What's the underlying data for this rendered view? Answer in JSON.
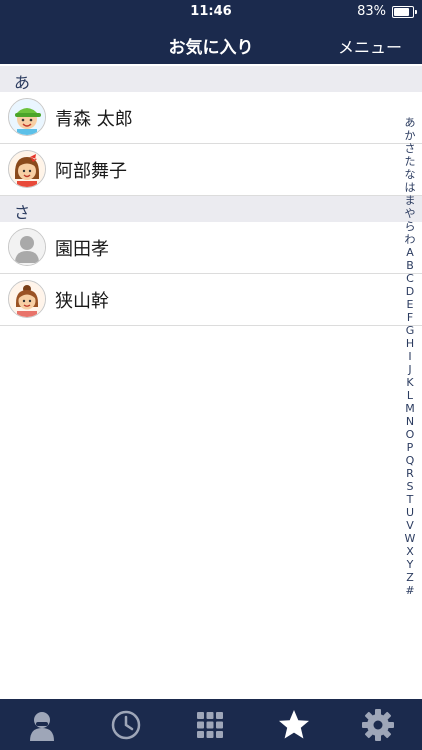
{
  "status": {
    "time": "11:46",
    "battery": "83%",
    "battery_level": 0.83
  },
  "nav": {
    "title": "お気に入り",
    "menu_label": "メニュー"
  },
  "sections": [
    {
      "label": "あ",
      "contacts": [
        {
          "name": "青森 太郎",
          "avatar": "boy-green-cap"
        },
        {
          "name": "阿部舞子",
          "avatar": "girl-red-bow"
        }
      ]
    },
    {
      "label": "さ",
      "contacts": [
        {
          "name": "園田孝",
          "avatar": "default-person"
        },
        {
          "name": "狭山幹",
          "avatar": "girl-brown-hair"
        }
      ]
    }
  ],
  "index_letters": [
    "あ",
    "か",
    "さ",
    "た",
    "な",
    "は",
    "ま",
    "や",
    "ら",
    "わ",
    "A",
    "B",
    "C",
    "D",
    "E",
    "F",
    "G",
    "H",
    "I",
    "J",
    "K",
    "L",
    "M",
    "N",
    "O",
    "P",
    "Q",
    "R",
    "S",
    "T",
    "U",
    "V",
    "W",
    "X",
    "Y",
    "Z",
    "#"
  ],
  "tabs": [
    {
      "icon": "person-icon",
      "active": false
    },
    {
      "icon": "clock-icon",
      "active": false
    },
    {
      "icon": "grid-icon",
      "active": false
    },
    {
      "icon": "star-icon",
      "active": true
    },
    {
      "icon": "gear-icon",
      "active": false
    }
  ],
  "colors": {
    "navy": "#1b2a4d",
    "section_bg": "#ebebf0",
    "tab_inactive": "#9ea6b8",
    "tab_active": "#ffffff"
  }
}
